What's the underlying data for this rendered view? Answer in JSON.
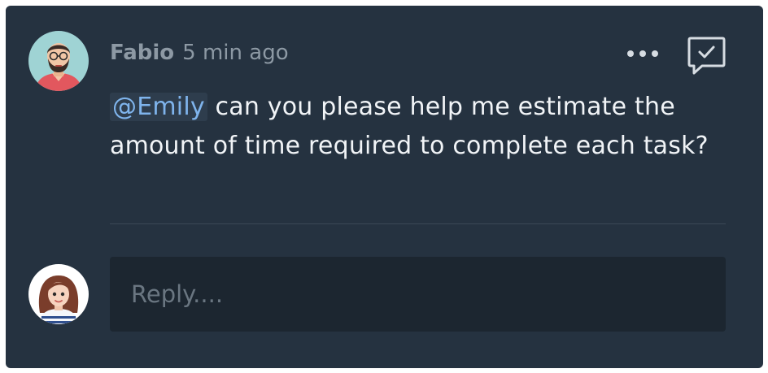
{
  "comment": {
    "author": "Fabio",
    "timestamp": "5 min ago",
    "mention": "@Emily",
    "text": " can you please help me estimate the amount of time required to complete each task?",
    "author_avatar_icon": "male-avatar",
    "more_icon": "more-horizontal-icon",
    "resolve_icon": "comment-check-icon"
  },
  "reply": {
    "placeholder": "Reply....",
    "value": "",
    "user_avatar_icon": "female-avatar"
  },
  "colors": {
    "card_background": "#253240",
    "input_background": "#1c2630",
    "mention": "#7fb4ec",
    "text": "#f1f4f7",
    "meta": "#8d99a4"
  }
}
